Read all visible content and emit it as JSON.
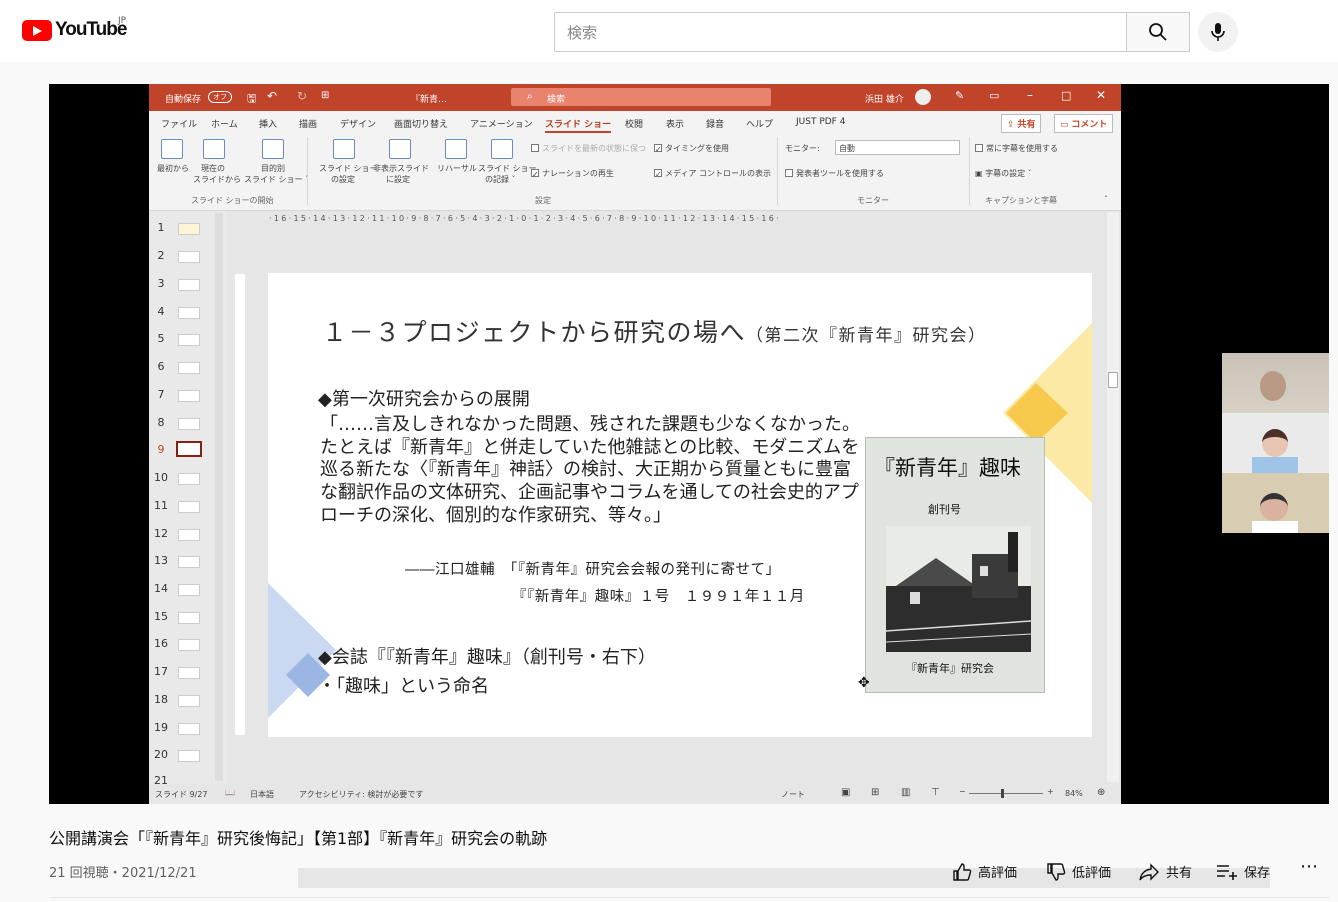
{
  "youtube": {
    "logo_text": "YouTube",
    "country": "JP",
    "search_placeholder": "検索"
  },
  "ppt": {
    "autosave": "自動保存",
    "autosave_state": "オフ",
    "file_name": "『新青…",
    "search_label": "検索",
    "user": "浜田 雄介",
    "menu": [
      "ファイル",
      "ホーム",
      "挿入",
      "描画",
      "デザイン",
      "画面切り替え",
      "アニメーション",
      "スライド ショー",
      "校閲",
      "表示",
      "録音",
      "ヘルプ",
      "JUST PDF 4"
    ],
    "active_menu": "スライド ショー",
    "share": "共有",
    "comment": "コメント",
    "ribbon": {
      "btn_from_start": "最初から",
      "btn_current_1": "現在の",
      "btn_current_2": "スライドから",
      "btn_custom_1": "目的別",
      "btn_custom_2": "スライド ショー ˇ",
      "group_start": "スライド ショーの開始",
      "btn_setup_1": "スライド ショー",
      "btn_setup_2": "の設定",
      "btn_hide_1": "非表示スライド",
      "btn_hide_2": "に設定",
      "btn_rehearse": "リハーサル",
      "btn_record_1": "スライド ショー",
      "btn_record_2": "の記録 ˇ",
      "chk_keep_fresh": "スライドを最新の状態に保つ",
      "chk_timing": "タイミングを使用",
      "chk_narration": "ナレーションの再生",
      "chk_media": "メディア コントロールの表示",
      "group_setup": "設定",
      "monitor_label": "モニター:",
      "monitor_value": "自動",
      "presenter_tools": "発表者ツールを使用する",
      "group_monitor": "モニター",
      "always_captions": "常に字幕を使用する",
      "caption_settings": "字幕の設定 ˇ",
      "group_captions": "キャプションと字幕"
    },
    "thumbnails": [
      "1",
      "2",
      "3",
      "4",
      "5",
      "6",
      "7",
      "8",
      "9",
      "10",
      "11",
      "12",
      "13",
      "14",
      "15",
      "16",
      "17",
      "18",
      "19",
      "20",
      "21"
    ],
    "ruler": "·16·15·14·13·12·11·10·9·8·7·6·5·4·3·2·1·0·1·2·3·4·5·6·7·8·9·10·11·12·13·14·15·16·",
    "status": {
      "slide_count": "スライド 9/27",
      "language": "日本語",
      "accessibility": "アクセシビリティ: 検討が必要です",
      "notes": "ノート",
      "zoom": "84%"
    },
    "slide": {
      "title": "１－３プロジェクトから研究の場へ",
      "title_sub": "（第二次『新青年』研究会）",
      "bullet1": "◆第一次研究会からの展開",
      "quote": "「……言及しきれなかった問題、残された課題も少なくなかった。たとえば『新青年』と併走していた他雑誌との比較、モダニズムを巡る新たな〈『新青年』神話〉の検討、大正期から質量ともに豊富な翻訳作品の文体研究、企画記事やコラムを通しての社会史的アプローチの深化、個別的な作家研究、等々。」",
      "source1": "――江口雄輔　「『新青年』研究会会報の発刊に寄せて」",
      "source2": "『『新青年』趣味』１号　１９９１年１１月",
      "bullet2": "◆会誌『『新青年』趣味』（創刊号・右下）",
      "bullet3": "・「趣味」という命名",
      "mag_title": "『新青年』趣味",
      "mag_issue": "創刊号",
      "mag_publisher": "『新青年』研究会"
    }
  },
  "video": {
    "title": "公開講演会「『新青年』研究後悔記」【第1部】『新青年』研究会の軌跡",
    "meta": "21 回視聴・2021/12/21",
    "like": "高評価",
    "dislike": "低評価",
    "share": "共有",
    "save": "保存"
  }
}
